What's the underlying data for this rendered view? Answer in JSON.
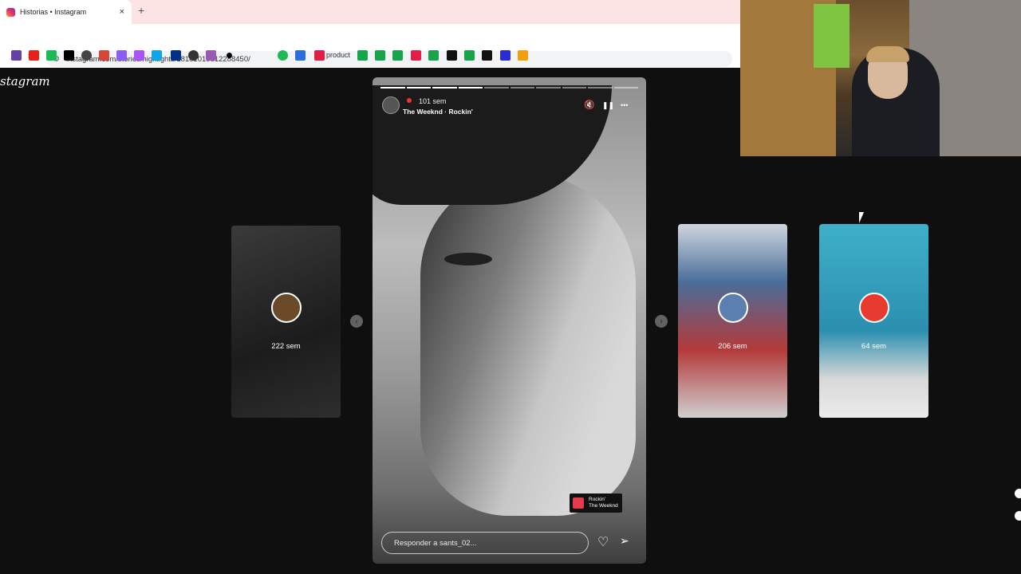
{
  "browser": {
    "tab_title": "Historias • Instagram",
    "tab_close": "×",
    "new_tab": "+",
    "url": "instagram.com/stories/highlights/18181019812288450/",
    "bookmark_label": "product",
    "bookmark_colors": [
      "#6441a5",
      "#e62117",
      "#1db954",
      "#000000",
      "#444444",
      "#d44638",
      "#8b5cf6",
      "#a855f7",
      "#0ea5e9",
      "#003087",
      "#333333",
      "#9b59b6",
      "#000000",
      "#1db954",
      "#2d6cdf",
      "#e11d48",
      "#16a34a",
      "#16a34a",
      "#16a34a",
      "#e11d48",
      "#16a34a",
      "#111111",
      "#16a34a",
      "#111111",
      "#2b2bd6",
      "#f59e0b"
    ]
  },
  "instagram": {
    "logo": "stagram",
    "side_stories": [
      {
        "label": "222 sem"
      },
      {
        "label": "206 sem"
      },
      {
        "label": "64 sem"
      }
    ],
    "prev_arrow": "‹",
    "next_arrow": "›",
    "story": {
      "time": "101 sem",
      "music": "The Weeknd · Rockin'",
      "mute_icon": "🔇",
      "pause_icon": "❚❚",
      "more_icon": "•••",
      "sticker_title": "Rockin'",
      "sticker_artist": "The Weeknd",
      "reply_placeholder": "Responder a sants_02...",
      "heart_icon": "♡",
      "send_icon": "➢",
      "progress_total": 10,
      "progress_done": 4
    }
  }
}
